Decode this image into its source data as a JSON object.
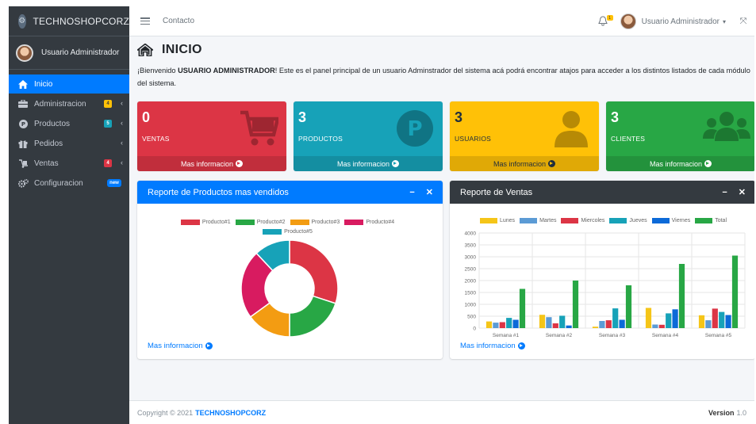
{
  "brand": {
    "name": "TECHNOSHOPCORZ"
  },
  "sidebar": {
    "user": "Usuario Administrador",
    "items": [
      {
        "label": "Inicio",
        "icon": "home-icon",
        "active": true
      },
      {
        "label": "Administracion",
        "icon": "briefcase-icon",
        "badge": "4",
        "badge_color": "#ffc107"
      },
      {
        "label": "Productos",
        "icon": "product-icon",
        "badge": "5",
        "badge_color": "#17a2b8"
      },
      {
        "label": "Pedidos",
        "icon": "gift-icon"
      },
      {
        "label": "Ventas",
        "icon": "dolly-icon",
        "badge": "4",
        "badge_color": "#dc3545"
      },
      {
        "label": "Configuracion",
        "icon": "cogs-icon",
        "badge": "new",
        "badge_color": "#007bff"
      }
    ]
  },
  "topbar": {
    "link": "Contacto",
    "bell_badge": "1",
    "user": "Usuario Administrador"
  },
  "page": {
    "title": "INICIO",
    "welcome_pre": "¡Bienvenido ",
    "welcome_user": "USUARIO ADMINISTRADOR",
    "welcome_post": "! Este es el panel principal de un usuario Adminstrador del sistema acá podrá encontrar atajos para acceder a los distintos listados de cada módulo del sistema."
  },
  "boxes": [
    {
      "value": "0",
      "label": "VENTAS",
      "link": "Mas informacion",
      "color": "#dc3545",
      "icon": "cart-icon"
    },
    {
      "value": "3",
      "label": "PRODUCTOS",
      "link": "Mas informacion",
      "color": "#17a2b8",
      "icon": "product-icon"
    },
    {
      "value": "3",
      "label": "USUARIOS",
      "link": "Mas informacion",
      "color": "#ffc107",
      "icon": "user-icon"
    },
    {
      "value": "3",
      "label": "CLIENTES",
      "link": "Mas informacion",
      "color": "#28a745",
      "icon": "users-icon"
    }
  ],
  "cards": {
    "products": {
      "title": "Reporte de Productos mas vendidos",
      "link": "Mas informacion",
      "color": "#007bff"
    },
    "sales": {
      "title": "Reporte de Ventas",
      "link": "Mas informacion",
      "color": "#343a40"
    }
  },
  "chart_data": [
    {
      "type": "pie",
      "variant": "doughnut",
      "labels": [
        "Producto#1",
        "Producto#2",
        "Producto#3",
        "Producto#4",
        "Producto#5"
      ],
      "values": [
        30,
        20,
        15,
        23,
        12
      ],
      "colors": [
        "#dc3545",
        "#28a745",
        "#f39c12",
        "#d81b60",
        "#17a2b8"
      ],
      "legend": "top"
    },
    {
      "type": "bar",
      "categories": [
        "Semana #1",
        "Semana #2",
        "Semana #3",
        "Semana #4",
        "Semana #5"
      ],
      "series": [
        {
          "name": "Lunes",
          "color": "#f5c518",
          "values": [
            280,
            560,
            60,
            850,
            540
          ]
        },
        {
          "name": "Martes",
          "color": "#5b9bd5",
          "values": [
            230,
            460,
            300,
            150,
            330
          ]
        },
        {
          "name": "Miercoles",
          "color": "#dc3545",
          "values": [
            250,
            200,
            330,
            140,
            820
          ]
        },
        {
          "name": "Jueves",
          "color": "#17a2b8",
          "values": [
            430,
            520,
            830,
            620,
            680
          ]
        },
        {
          "name": "Viernes",
          "color": "#0c6ad8",
          "values": [
            350,
            110,
            350,
            790,
            550
          ]
        },
        {
          "name": "Total",
          "color": "#28a745",
          "values": [
            1650,
            2000,
            1800,
            2700,
            3050
          ]
        }
      ],
      "ylim": [
        0,
        4000
      ],
      "yticks": [
        "0",
        "500",
        "1000",
        "1500",
        "2000",
        "2500",
        "3000",
        "3500",
        "4000"
      ],
      "grid": true,
      "legend": "top"
    }
  ],
  "footer": {
    "copyright": "Copyright © 2021",
    "brand": "TECHNOSHOPCORZ",
    "version_label": "Version",
    "version": "1.0"
  }
}
